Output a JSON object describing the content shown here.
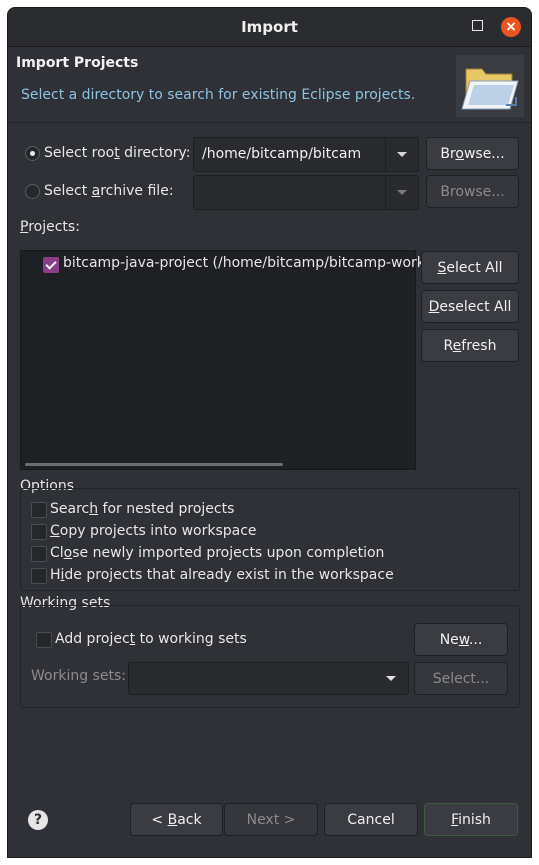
{
  "window": {
    "title": "Import"
  },
  "banner": {
    "heading": "Import Projects",
    "description": "Select a directory to search for existing Eclipse projects."
  },
  "source": {
    "root_dir_label_pre": "Select roo",
    "root_dir_label_mn": "t",
    "root_dir_label_post": " directory:",
    "root_dir_value": "/home/bitcamp/bitcam",
    "root_dir_selected": true,
    "browse_pre": "Br",
    "browse_mn": "o",
    "browse_post": "wse...",
    "archive_label_pre": "Select ",
    "archive_label_mn": "a",
    "archive_label_post": "rchive file:",
    "archive_value": "",
    "browse_disabled_label": "Browse..."
  },
  "projects": {
    "label_mn": "P",
    "label_post": "rojects:",
    "items": [
      {
        "label": "bitcamp-java-project (/home/bitcamp/bitcamp-work",
        "checked": true
      }
    ],
    "select_all_pre": "",
    "select_all_mn": "S",
    "select_all_post": "elect All",
    "deselect_all_mn": "D",
    "deselect_all_post": "eselect All",
    "refresh_pre": "R",
    "refresh_mn": "e",
    "refresh_post": "fresh"
  },
  "options": {
    "title": "Options",
    "items": [
      {
        "pre": "Searc",
        "mn": "h",
        "post": " for nested projects",
        "checked": false
      },
      {
        "pre": "",
        "mn": "C",
        "post": "opy projects into workspace",
        "checked": false
      },
      {
        "pre": "Cl",
        "mn": "o",
        "post": "se newly imported projects upon completion",
        "checked": false
      },
      {
        "pre": "H",
        "mn": "i",
        "post": "de projects that already exist in the workspace",
        "checked": false
      }
    ]
  },
  "working_sets": {
    "title": "Working sets",
    "add_pre": "Add projec",
    "add_mn": "t",
    "add_post": " to working sets",
    "add_checked": false,
    "new_pre": "Ne",
    "new_mn": "w",
    "new_post": "...",
    "sets_label": "Working sets:",
    "sets_value": "",
    "select_label": "Select..."
  },
  "footer": {
    "help_glyph": "?",
    "back_pre": "< ",
    "back_mn": "B",
    "back_post": "ack",
    "next_label": "Next >",
    "cancel_label": "Cancel",
    "finish_mn": "F",
    "finish_post": "inish"
  },
  "colors": {
    "dialog_bg": "#2f3136",
    "accent_close": "#e95420",
    "checkbox_checked": "#8a3e87",
    "banner_text": "#8ec1de"
  }
}
